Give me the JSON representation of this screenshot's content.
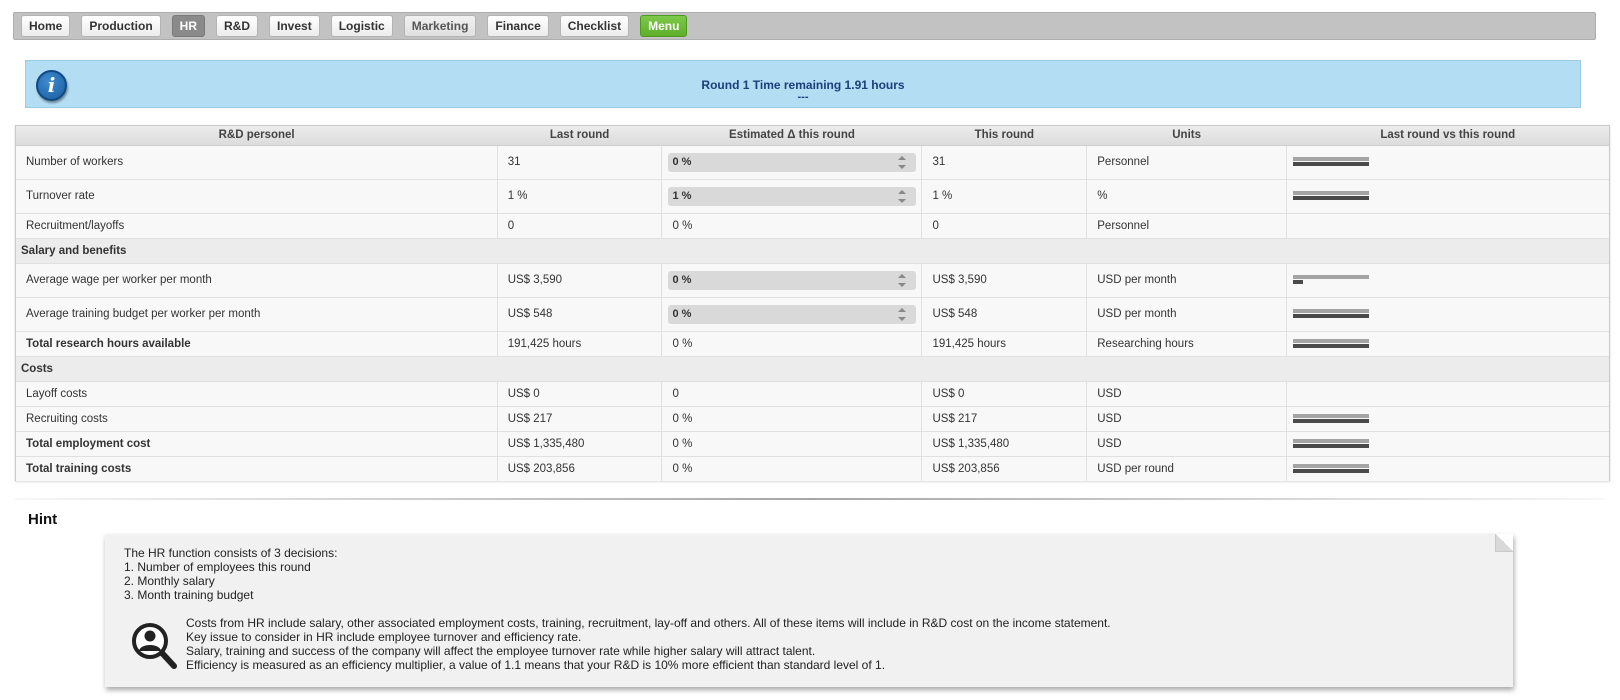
{
  "nav": {
    "tabs": [
      {
        "label": "Home",
        "state": "normal"
      },
      {
        "label": "Production",
        "state": "normal"
      },
      {
        "label": "HR",
        "state": "active"
      },
      {
        "label": "R&D",
        "state": "normal"
      },
      {
        "label": "Invest",
        "state": "normal"
      },
      {
        "label": "Logistic",
        "state": "normal"
      },
      {
        "label": "Marketing",
        "state": "muted"
      },
      {
        "label": "Finance",
        "state": "normal"
      },
      {
        "label": "Checklist",
        "state": "normal"
      },
      {
        "label": "Menu",
        "state": "menu"
      }
    ]
  },
  "info": {
    "icon": "info-icon",
    "text": "Round 1 Time remaining 1.91 hours",
    "sub": "---",
    "color": "#b2ddf3"
  },
  "table": {
    "headers": [
      "R&D personel",
      "Last round",
      "Estimated Δ this round",
      "This round",
      "Units",
      "Last round vs this round"
    ],
    "rows": [
      {
        "label": "Number of workers",
        "bold": false,
        "last": "31",
        "delta": "0 %",
        "delta_input": true,
        "this": "31",
        "unit": "Personnel",
        "bar_last": 1.0,
        "bar_this": 1.0,
        "height": "h34"
      },
      {
        "label": "Turnover rate",
        "bold": false,
        "last": "1 %",
        "delta": "1 %",
        "delta_input": true,
        "this": "1 %",
        "unit": "%",
        "bar_last": 1.0,
        "bar_this": 1.0,
        "height": "h34"
      },
      {
        "label": "Recruitment/layoffs",
        "bold": false,
        "last": "0",
        "delta": "0 %",
        "delta_input": false,
        "this": "0",
        "unit": "Personnel",
        "bar_last": null,
        "bar_this": null,
        "height": "h25"
      },
      {
        "section": "Salary and benefits"
      },
      {
        "label": "Average wage per worker per month",
        "bold": false,
        "last": "US$ 3,590",
        "delta": "0 %",
        "delta_input": true,
        "this": "US$ 3,590",
        "unit": "USD per month",
        "bar_last": 1.0,
        "bar_this": 0.13,
        "height": "h34"
      },
      {
        "label": "Average training budget per worker per month",
        "bold": false,
        "last": "US$ 548",
        "delta": "0 %",
        "delta_input": true,
        "this": "US$ 548",
        "unit": "USD per month",
        "bar_last": 1.0,
        "bar_this": 1.0,
        "height": "h34"
      },
      {
        "label": "Total research hours available",
        "bold": true,
        "last": "191,425 hours",
        "delta": "0 %",
        "delta_input": false,
        "this": "191,425 hours",
        "unit": "Researching hours",
        "bar_last": 1.0,
        "bar_this": 1.0,
        "height": "h25"
      },
      {
        "section": "Costs"
      },
      {
        "label": "Layoff costs",
        "bold": false,
        "last": "US$ 0",
        "delta": "0",
        "delta_input": false,
        "this": "US$ 0",
        "unit": "USD",
        "bar_last": null,
        "bar_this": null,
        "height": "h25"
      },
      {
        "label": "Recruiting costs",
        "bold": false,
        "last": "US$ 217",
        "delta": "0 %",
        "delta_input": false,
        "this": "US$ 217",
        "unit": "USD",
        "bar_last": 1.0,
        "bar_this": 1.0,
        "height": "h25"
      },
      {
        "label": "Total employment cost",
        "bold": true,
        "last": "US$ 1,335,480",
        "delta": "0 %",
        "delta_input": false,
        "this": "US$ 1,335,480",
        "unit": "USD",
        "bar_last": 1.0,
        "bar_this": 1.0,
        "height": "h25"
      },
      {
        "label": "Total training costs",
        "bold": true,
        "last": "US$ 203,856",
        "delta": "0 %",
        "delta_input": false,
        "this": "US$ 203,856",
        "unit": "USD per round",
        "bar_last": 1.0,
        "bar_this": 1.0,
        "height": "h25"
      }
    ]
  },
  "hint": {
    "title": "Hint",
    "icon": "magnifier-person-icon",
    "lines": [
      "The HR function consists of 3 decisions:",
      "1. Number of employees this round",
      "2. Monthly salary",
      "3. Month training budget"
    ],
    "details": [
      "Costs from HR include salary, other associated employment costs, training, recruitment, lay-off and others. All of these items will include in R&D cost on the income statement.",
      "Key issue to consider in HR include employee turnover and efficiency rate.",
      "Salary, training and success of the company will affect the employee turnover rate while higher salary will attract talent.",
      "Efficiency is measured as an efficiency multiplier, a value of 1.1 means that your R&D is 10% more efficient than standard level of 1."
    ]
  }
}
